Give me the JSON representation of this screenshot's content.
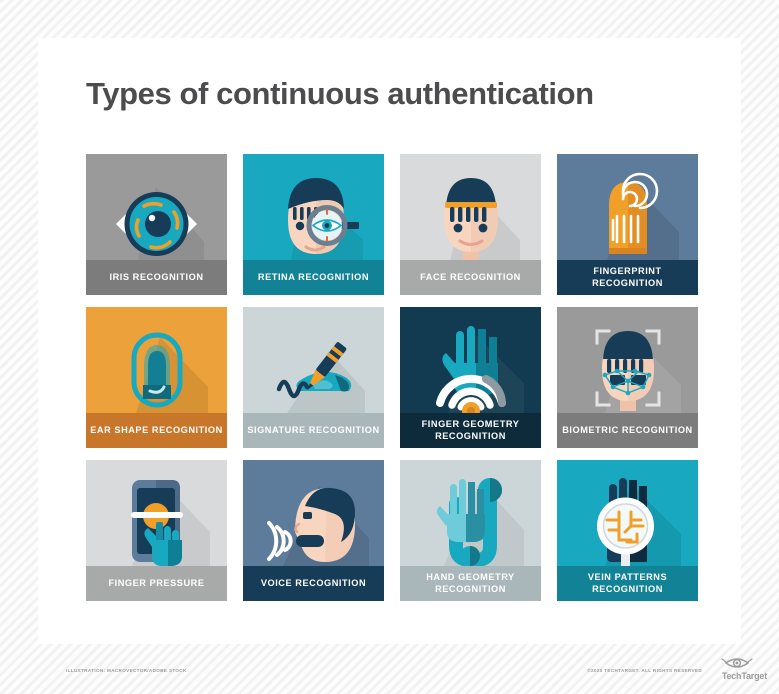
{
  "header": {
    "title": "Types of continuous authentication"
  },
  "tiles": [
    {
      "label": "IRIS RECOGNITION",
      "icon": "iris-icon",
      "bg": "#9a9a9a",
      "bar": "#7c7c7c"
    },
    {
      "label": "RETINA RECOGNITION",
      "icon": "retina-icon",
      "bg": "#18a9c0",
      "bar": "#128397"
    },
    {
      "label": "FACE RECOGNITION",
      "icon": "face-icon",
      "bg": "#d8dadb",
      "bar": "#a8a9a9"
    },
    {
      "label": "FINGERPRINT RECOGNITION",
      "icon": "fingerprint-icon",
      "bg": "#5d7c9b",
      "bar": "#173c58"
    },
    {
      "label": "EAR SHAPE RECOGNITION",
      "icon": "ear-icon",
      "bg": "#eda13a",
      "bar": "#c8762a"
    },
    {
      "label": "SIGNATURE RECOGNITION",
      "icon": "signature-icon",
      "bg": "#ccd5d7",
      "bar": "#aab7ba"
    },
    {
      "label": "FINGER GEOMETRY RECOGNITION",
      "icon": "finger-geometry-icon",
      "bg": "#123a50",
      "bar": "#0d2b3b"
    },
    {
      "label": "BIOMETRIC RECOGNITION",
      "icon": "biometric-icon",
      "bg": "#9a9a9a",
      "bar": "#7c7c7c"
    },
    {
      "label": "FINGER PRESSURE",
      "icon": "finger-pressure-icon",
      "bg": "#d8dadb",
      "bar": "#a8a9a9"
    },
    {
      "label": "VOICE RECOGNITION",
      "icon": "voice-icon",
      "bg": "#5d7c9b",
      "bar": "#173c58"
    },
    {
      "label": "HAND GEOMETRY RECOGNITION",
      "icon": "hand-geometry-icon",
      "bg": "#ccd5d7",
      "bar": "#aab7ba"
    },
    {
      "label": "VEIN PATTERNS RECOGNITION",
      "icon": "vein-patterns-icon",
      "bg": "#18a9c0",
      "bar": "#128397"
    }
  ],
  "footer": {
    "credit": "ILLUSTRATION: MACROVECTOR/ADOBE STOCK",
    "copyright": "©2020 TECHTARGET. ALL RIGHTS RESERVED",
    "logo_text": "TechTarget",
    "logo_icon": "techtarget-eye-icon"
  },
  "colors": {
    "title": "#4c4c4e",
    "teal": "#18a9c0",
    "orange": "#f0a028",
    "navy": "#173c58",
    "skin": "#f7d5be"
  }
}
